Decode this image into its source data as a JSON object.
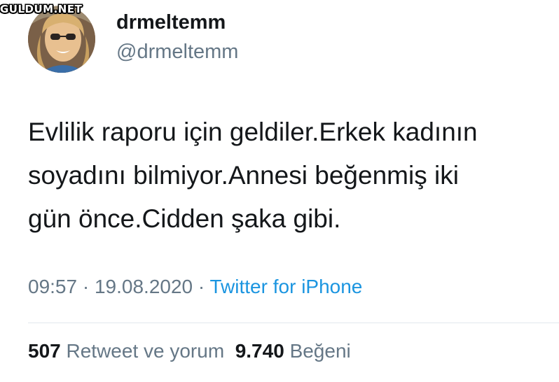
{
  "watermark": {
    "text": "GULDUM.NET"
  },
  "tweet": {
    "display_name": "drmeltemm",
    "handle": "@drmeltemm",
    "text_lines": [
      "Evlilik raporu için geldiler.Erkek kadının",
      "soyadını bilmiyor.Annesi beğenmiş iki",
      "gün önce.Cidden şaka gibi."
    ],
    "time": "09:57",
    "date": "19.08.2020",
    "separator": "·",
    "source": "Twitter for iPhone",
    "retweets_count": "507",
    "retweets_label": "Retweet ve yorum",
    "likes_count": "9.740",
    "likes_label": "Beğeni"
  },
  "colors": {
    "text": "#14171a",
    "secondary": "#657786",
    "link": "#1b95e0",
    "divider": "#e1e8ed"
  }
}
